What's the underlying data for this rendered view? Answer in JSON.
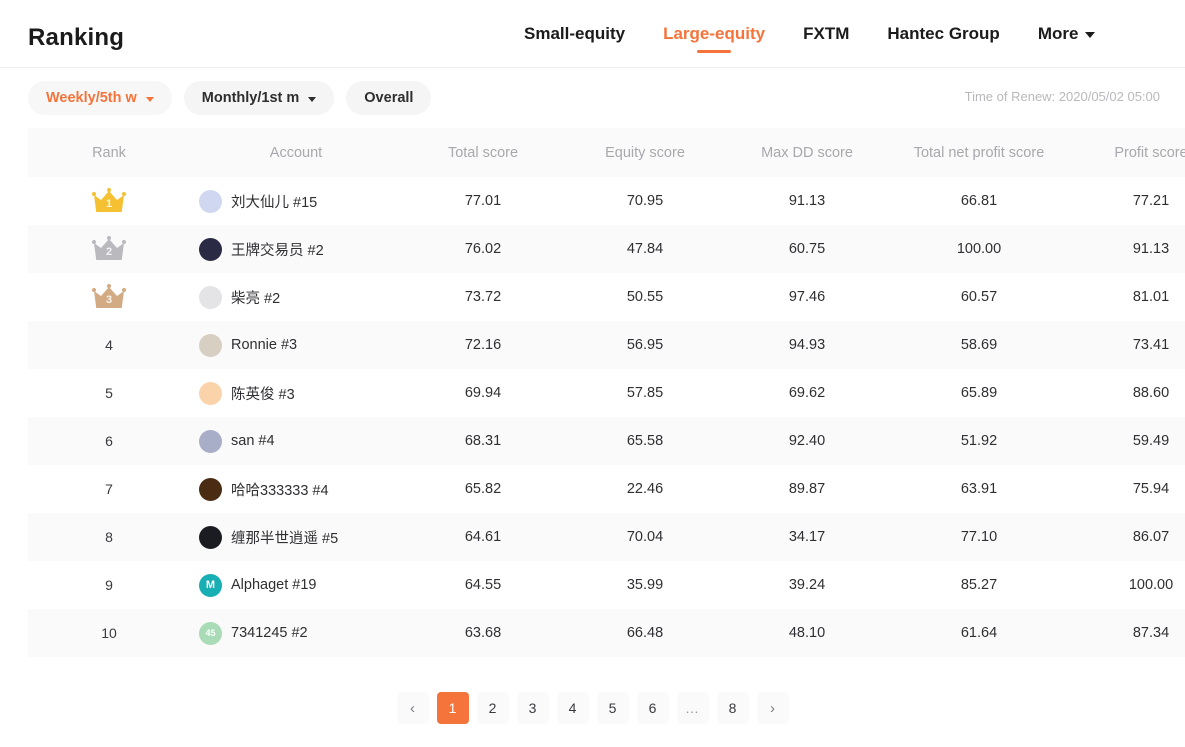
{
  "header": {
    "title": "Ranking",
    "tabs": [
      {
        "label": "Small-equity",
        "active": false,
        "caret": false
      },
      {
        "label": "Large-equity",
        "active": true,
        "caret": false
      },
      {
        "label": "FXTM",
        "active": false,
        "caret": false
      },
      {
        "label": "Hantec Group",
        "active": false,
        "caret": false
      },
      {
        "label": "More",
        "active": false,
        "caret": true
      }
    ]
  },
  "filters": {
    "chips": [
      {
        "label": "Weekly/5th w",
        "caret": true,
        "accent": true
      },
      {
        "label": "Monthly/1st m",
        "caret": true,
        "accent": false
      },
      {
        "label": "Overall",
        "caret": false,
        "accent": false
      }
    ],
    "renew_time": "Time of Renew: 2020/05/02 05:00"
  },
  "table": {
    "columns": [
      "Rank",
      "Account",
      "Total score",
      "Equity score",
      "Max DD score",
      "Total net profit score",
      "Profit score"
    ],
    "rows": [
      {
        "rank": "1",
        "medal": "gold",
        "account": "刘大仙儿 #15",
        "avatar_type": "image",
        "avatar_color": "#cfd8f0",
        "avatar_initial": "",
        "total": "77.01",
        "equity": "70.95",
        "maxdd": "91.13",
        "netprofit": "66.81",
        "profit": "77.21"
      },
      {
        "rank": "2",
        "medal": "silver",
        "account": "王牌交易员 #2",
        "avatar_type": "image",
        "avatar_color": "#2a2a44",
        "avatar_initial": "",
        "total": "76.02",
        "equity": "47.84",
        "maxdd": "60.75",
        "netprofit": "100.00",
        "profit": "91.13"
      },
      {
        "rank": "3",
        "medal": "bronze",
        "account": "柴亮 #2",
        "avatar_type": "image",
        "avatar_color": "#e4e4e6",
        "avatar_initial": "",
        "total": "73.72",
        "equity": "50.55",
        "maxdd": "97.46",
        "netprofit": "60.57",
        "profit": "81.01"
      },
      {
        "rank": "4",
        "medal": "",
        "account": "Ronnie #3",
        "avatar_type": "image",
        "avatar_color": "#d8cfc3",
        "avatar_initial": "",
        "total": "72.16",
        "equity": "56.95",
        "maxdd": "94.93",
        "netprofit": "58.69",
        "profit": "73.41"
      },
      {
        "rank": "5",
        "medal": "",
        "account": "陈英俊 #3",
        "avatar_type": "image",
        "avatar_color": "#fbd3ab",
        "avatar_initial": "",
        "total": "69.94",
        "equity": "57.85",
        "maxdd": "69.62",
        "netprofit": "65.89",
        "profit": "88.60"
      },
      {
        "rank": "6",
        "medal": "",
        "account": "san #4",
        "avatar_type": "image",
        "avatar_color": "#a9aec8",
        "avatar_initial": "",
        "total": "68.31",
        "equity": "65.58",
        "maxdd": "92.40",
        "netprofit": "51.92",
        "profit": "59.49"
      },
      {
        "rank": "7",
        "medal": "",
        "account": "哈哈333333 #4",
        "avatar_type": "image",
        "avatar_color": "#4a2c12",
        "avatar_initial": "",
        "total": "65.82",
        "equity": "22.46",
        "maxdd": "89.87",
        "netprofit": "63.91",
        "profit": "75.94"
      },
      {
        "rank": "8",
        "medal": "",
        "account": "缠那半世逍遥 #5",
        "avatar_type": "image",
        "avatar_color": "#1b1b22",
        "avatar_initial": "",
        "total": "64.61",
        "equity": "70.04",
        "maxdd": "34.17",
        "netprofit": "77.10",
        "profit": "86.07"
      },
      {
        "rank": "9",
        "medal": "",
        "account": "Alphaget #19",
        "avatar_type": "initial",
        "avatar_color": "#17aeb4",
        "avatar_initial": "M",
        "total": "64.55",
        "equity": "35.99",
        "maxdd": "39.24",
        "netprofit": "85.27",
        "profit": "100.00"
      },
      {
        "rank": "10",
        "medal": "",
        "account": "7341245 #2",
        "avatar_type": "initial",
        "avatar_color": "#a8dbb6",
        "avatar_initial": "45",
        "total": "63.68",
        "equity": "66.48",
        "maxdd": "48.10",
        "netprofit": "61.64",
        "profit": "87.34"
      }
    ]
  },
  "pagination": {
    "prev": "‹",
    "next": "›",
    "pages": [
      "1",
      "2",
      "3",
      "4",
      "5",
      "6",
      "…",
      "8"
    ],
    "active": "1"
  },
  "colors": {
    "accent": "#f4743b",
    "gold": "#f5c132",
    "silver": "#b9b9be",
    "bronze": "#d2ab84"
  }
}
